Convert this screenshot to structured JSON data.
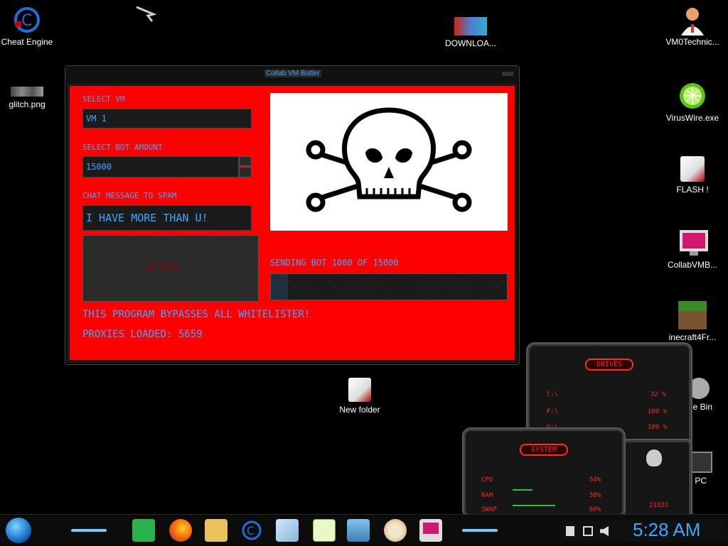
{
  "desktop": {
    "icons": [
      {
        "label": "Cheat Engine",
        "icon": "cheat-engine-icon"
      },
      {
        "label": "glitch.png",
        "icon": "image-file-icon"
      },
      {
        "label": "DOWNLOA...",
        "icon": "download-icon"
      },
      {
        "label": "VM0Technic...",
        "icon": "user-doctor-icon"
      },
      {
        "label": "VirusWire.exe",
        "icon": "lime-icon"
      },
      {
        "label": "FLASH !",
        "icon": "folder-icon"
      },
      {
        "label": "CollabVMB...",
        "icon": "monitor-icon"
      },
      {
        "label": "inecraft4Fr...",
        "icon": "minecraft-icon"
      },
      {
        "label": "New folder",
        "icon": "folder-icon"
      },
      {
        "label": "ycle Bin",
        "icon": "recycle-bin-icon"
      },
      {
        "label": "is PC",
        "icon": "computer-icon"
      }
    ]
  },
  "app": {
    "title": "Collab VM Botter",
    "select_vm_label": "SELECT VM",
    "select_vm_value": "VM 1",
    "bot_amount_label": "SELECT BOT AMOUNT",
    "bot_amount_value": "15000",
    "chat_label": "CHAT MESSAGE TO SPAM",
    "chat_value": "I HAVE MORE THAN U!",
    "attack_label": "ATTACK",
    "status_text": "SENDING BOT 1080 OF 15000",
    "progress": 0.072,
    "bypass_text": "THIS PROGRAM BYPASSES ALL WHITELISTER!",
    "proxies_text": "PROXIES LOADED: 5659",
    "image_icon": "skull-crossbones-icon"
  },
  "drives_gadget": {
    "title": "DRIVES",
    "rows": [
      {
        "label": "C:\\",
        "value": "32 %"
      },
      {
        "label": "F:\\",
        "value": "100 %"
      },
      {
        "label": "G:\\",
        "value": "100 %"
      }
    ]
  },
  "system_gadget": {
    "title": "SYSTEM",
    "rows": [
      {
        "label": "CPU",
        "value": "54%"
      },
      {
        "label": "RAM",
        "value": "58%"
      },
      {
        "label": "SWAP",
        "value": "60%"
      }
    ],
    "footer": "21823"
  },
  "taskbar": {
    "clock": "5:28 AM",
    "apps": [
      "feedly-icon",
      "firefox-icon",
      "file-explorer-icon",
      "cheat-engine-icon",
      "notepad-icon",
      "sticky-notes-icon",
      "photo-viewer-icon",
      "paint-icon",
      "monitor-icon"
    ]
  },
  "colors": {
    "window_bg": "#ff0000",
    "text_accent": "#3aa8ff",
    "gadget_accent": "#ff2a2a"
  }
}
